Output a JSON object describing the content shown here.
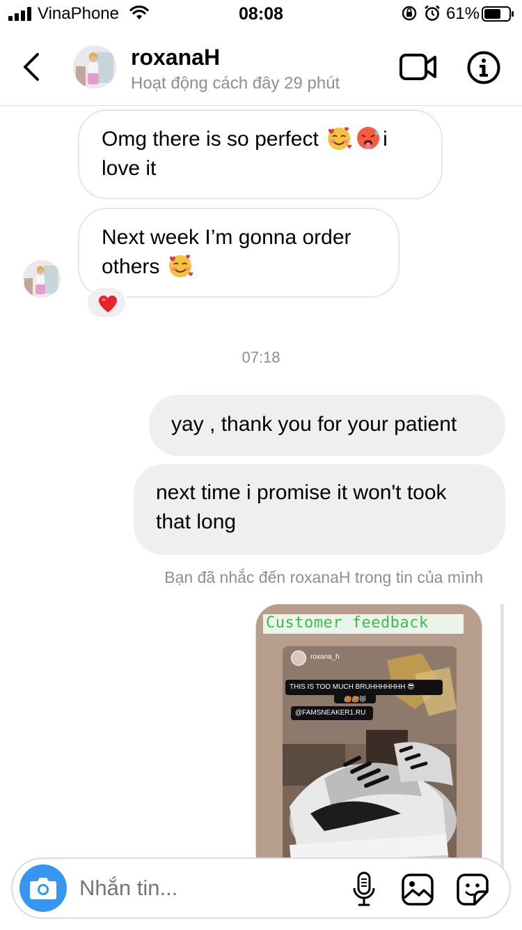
{
  "status_bar": {
    "carrier": "VinaPhone",
    "time": "08:08",
    "battery": "61%",
    "icons": [
      "signal-icon",
      "wifi-icon",
      "orientation-lock-icon",
      "alarm-icon",
      "battery-icon"
    ]
  },
  "header": {
    "username": "roxanaH",
    "activity": "Hoạt động cách đây 29 phút",
    "icons": [
      "back-arrow-icon",
      "video-call-icon",
      "info-icon"
    ]
  },
  "messages": {
    "incoming": [
      {
        "text_before": "Omg there is so perfect ",
        "emojis": [
          "smiling-face-with-hearts-emoji",
          "hot-face-emoji"
        ],
        "text_after": "i love it"
      },
      {
        "text_before": "Next week I’m gonna order others ",
        "emojis": [
          "smiling-face-with-hearts-emoji"
        ],
        "text_after": "",
        "reaction": "red-heart-emoji"
      }
    ],
    "timestamp": "07:18",
    "outgoing": [
      {
        "text": "yay , thank you for your patient"
      },
      {
        "text": "next time i promise it won't took that long"
      }
    ],
    "mention_note": "Bạn đã nhắc đến roxanaH trong tin của mình"
  },
  "story": {
    "tag_text": "Customer feedback",
    "inner_username": "roxana_h",
    "sticker_text": "THIS IS TOO MUCH BRUHHHHHHH 😎",
    "sticker_emojis": "🥵🥵😻",
    "mention_sticker": "@FAMSNEAKER1.RU"
  },
  "composer": {
    "placeholder": "Nhắn tin...",
    "icons": [
      "camera-icon",
      "microphone-icon",
      "gallery-icon",
      "sticker-icon"
    ]
  },
  "colors": {
    "accent_blue": "#3797f0",
    "outgoing_bubble": "#efefef",
    "secondary_text": "#8e8e8e",
    "story_tag_green": "#3bbd4a"
  }
}
